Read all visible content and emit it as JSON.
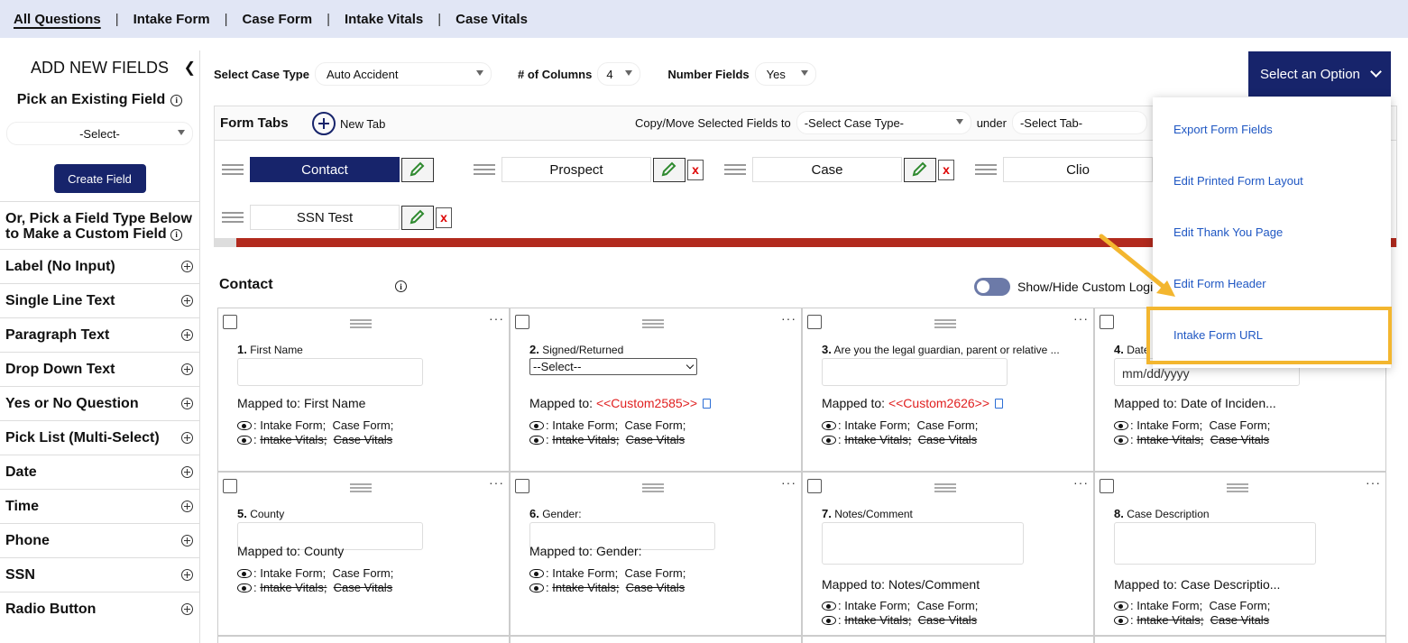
{
  "top_tabs": [
    "All Questions",
    "Intake Form",
    "Case Form",
    "Intake Vitals",
    "Case Vitals"
  ],
  "top_sep": "|",
  "sidebar": {
    "title": "ADD NEW FIELDS",
    "collapse_icon": "chevron-left-icon",
    "pick_existing": "Pick an Existing Field",
    "select_placeholder": "-Select-",
    "create_button": "Create Field",
    "custom_heading": "Or, Pick a Field Type Below to Make a Custom Field",
    "field_types": [
      "Label (No Input)",
      "Single Line Text",
      "Paragraph Text",
      "Drop Down Text",
      "Yes or No Question",
      "Pick List (Multi-Select)",
      "Date",
      "Time",
      "Phone",
      "SSN",
      "Radio Button"
    ]
  },
  "toolbar": {
    "case_type_label": "Select Case Type",
    "case_type_value": "Auto Accident",
    "columns_label": "# of Columns",
    "columns_value": "4",
    "number_fields_label": "Number Fields",
    "number_fields_value": "Yes",
    "options_button": "Select an Option"
  },
  "form_tabs": {
    "title": "Form Tabs",
    "new_tab": "New Tab",
    "copy_move_label": "Copy/Move Selected Fields to",
    "case_type_select": "-Select Case Type-",
    "under_label": "under",
    "tab_select": "-Select Tab-",
    "tabs": [
      "Contact",
      "Prospect",
      "Case",
      "Clio",
      "SSN Test"
    ],
    "delete_glyph": "x"
  },
  "section": {
    "title": "Contact",
    "toggle_label": "Show/Hide Custom Logi"
  },
  "mapped_prefix": "Mapped to:",
  "vis_items": {
    "intake_form": "Intake Form;",
    "case_form": "Case Form;",
    "intake_vitals": "Intake Vitals;",
    "case_vitals": "Case Vitals"
  },
  "fields": [
    {
      "num": "1.",
      "label": "First Name",
      "mapped": "First Name"
    },
    {
      "num": "2.",
      "label": "Signed/Returned",
      "select": "--Select--",
      "mapped": "<<Custom2585>>"
    },
    {
      "num": "3.",
      "label": "Are you the legal guardian, parent or relative ...",
      "mapped": "<<Custom2626>>"
    },
    {
      "num": "4.",
      "label": "Date",
      "placeholder": "mm/dd/yyyy",
      "mapped": "Date of Inciden..."
    },
    {
      "num": "5.",
      "label": "County",
      "mapped": "County"
    },
    {
      "num": "6.",
      "label": "Gender:",
      "mapped": "Gender:"
    },
    {
      "num": "7.",
      "label": "Notes/Comment",
      "mapped": "Notes/Comment"
    },
    {
      "num": "8.",
      "label": "Case Description",
      "mapped": "Case Descriptio..."
    }
  ],
  "dropdown_menu": {
    "items": [
      "Export Form Fields",
      "Edit Printed Form Layout",
      "Edit Thank You Page",
      "Edit Form Header",
      "Intake Form URL"
    ],
    "highlighted": "Intake Form URL",
    "highlight_color": "#f3b62f"
  },
  "colors": {
    "navy": "#17246b",
    "topbar": "#e1e6f5",
    "red_bar": "#b22a1e",
    "link": "#1f57c3",
    "custom_red": "#e02020"
  }
}
